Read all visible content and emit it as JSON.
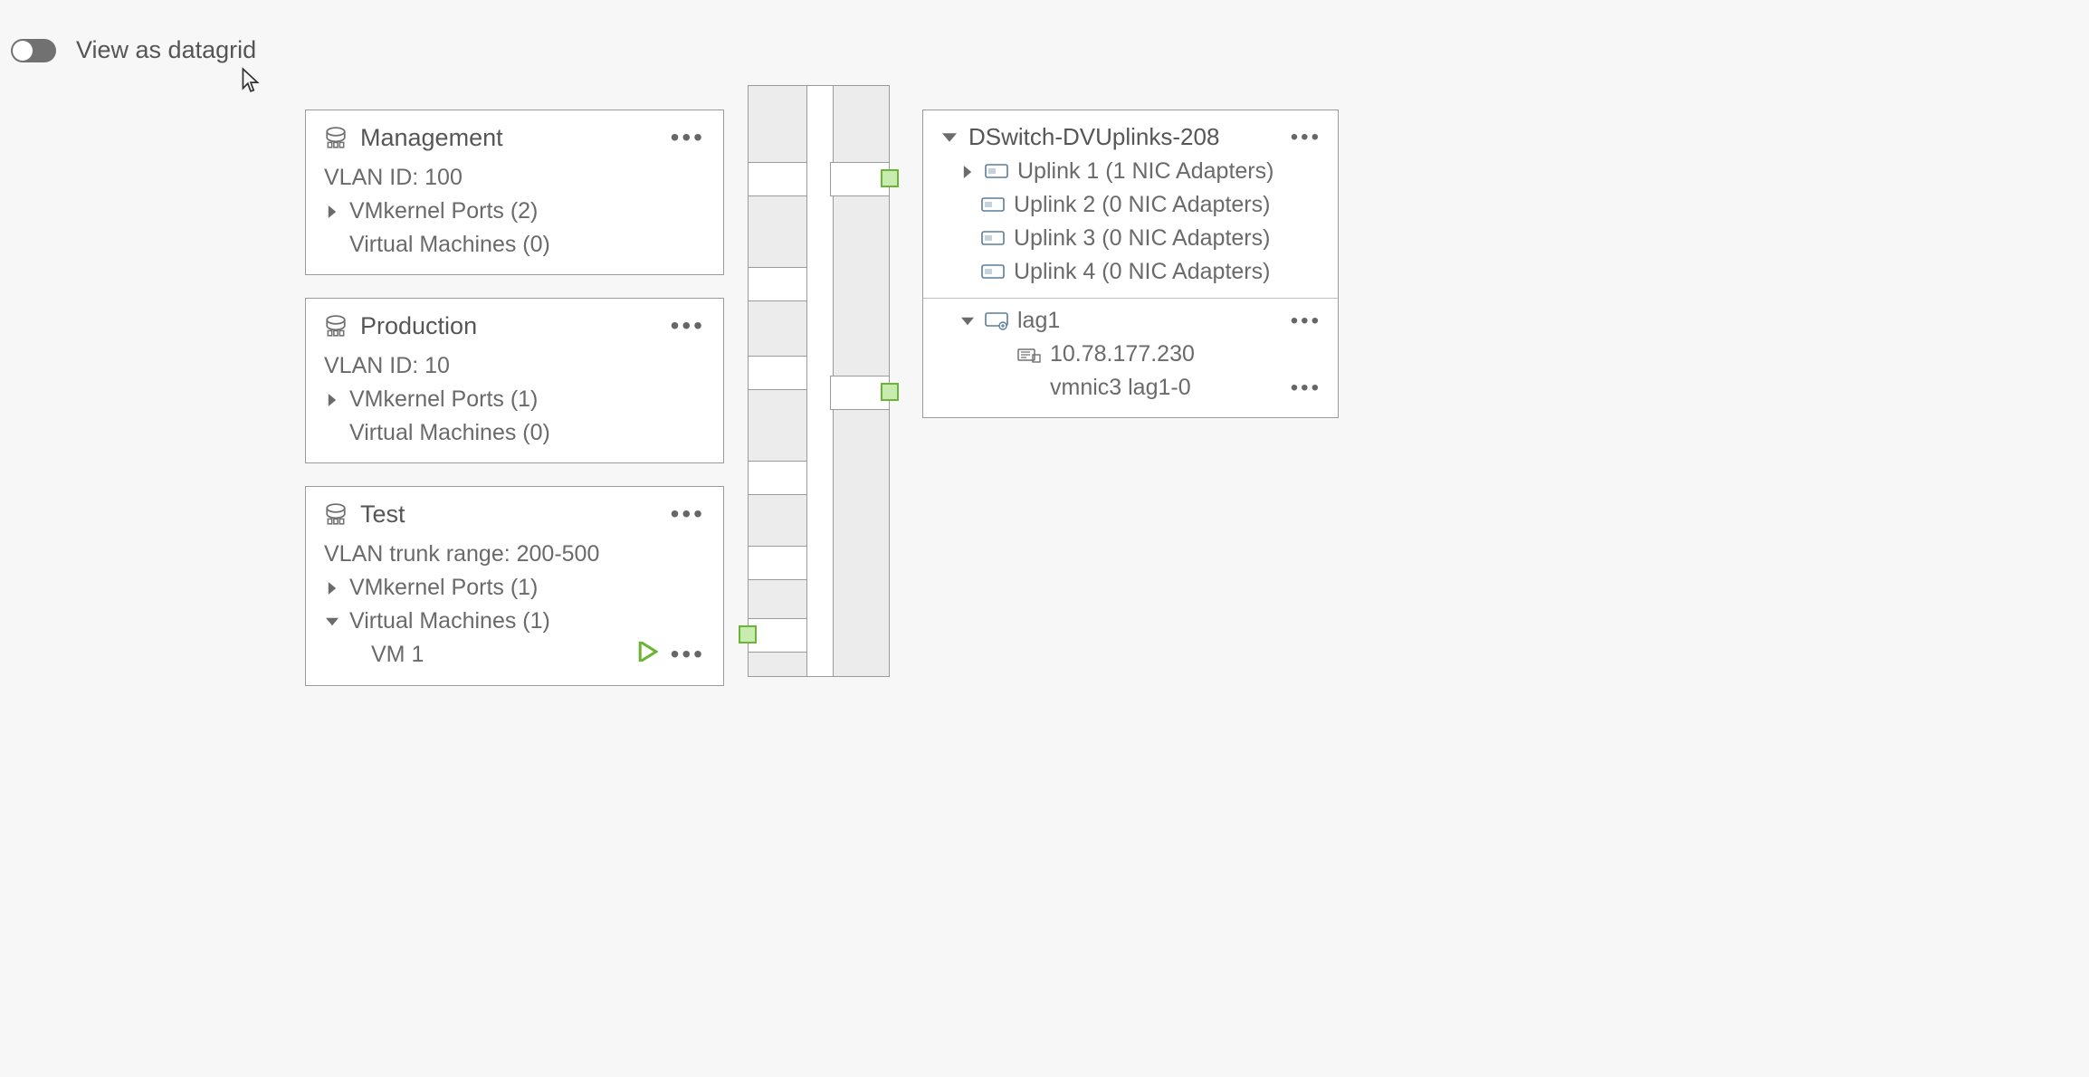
{
  "header": {
    "toggle_label": "View as datagrid",
    "toggle_on": false
  },
  "port_groups": [
    {
      "name": "Management",
      "vlan_label": "VLAN ID: 100",
      "vmk_label": "VMkernel Ports (2)",
      "vm_label": "Virtual Machines (0)",
      "vmk_expanded": false,
      "vm_expanded": false,
      "vms": []
    },
    {
      "name": "Production",
      "vlan_label": "VLAN ID: 10",
      "vmk_label": "VMkernel Ports (1)",
      "vm_label": "Virtual Machines (0)",
      "vmk_expanded": false,
      "vm_expanded": false,
      "vms": []
    },
    {
      "name": "Test",
      "vlan_label": "VLAN trunk range: 200-500",
      "vmk_label": "VMkernel Ports (1)",
      "vm_label": "Virtual Machines (1)",
      "vmk_expanded": false,
      "vm_expanded": true,
      "vms": [
        {
          "name": "VM 1"
        }
      ]
    }
  ],
  "uplinks": {
    "title": "DSwitch-DVUplinks-208",
    "items": [
      {
        "label": "Uplink 1 (1 NIC Adapters)",
        "expandable": true
      },
      {
        "label": "Uplink 2 (0 NIC Adapters)",
        "expandable": false
      },
      {
        "label": "Uplink 3 (0 NIC Adapters)",
        "expandable": false
      },
      {
        "label": "Uplink 4 (0 NIC Adapters)",
        "expandable": false
      }
    ],
    "lag": {
      "name": "lag1",
      "host": "10.78.177.230",
      "nic": "vmnic3 lag1-0"
    }
  }
}
